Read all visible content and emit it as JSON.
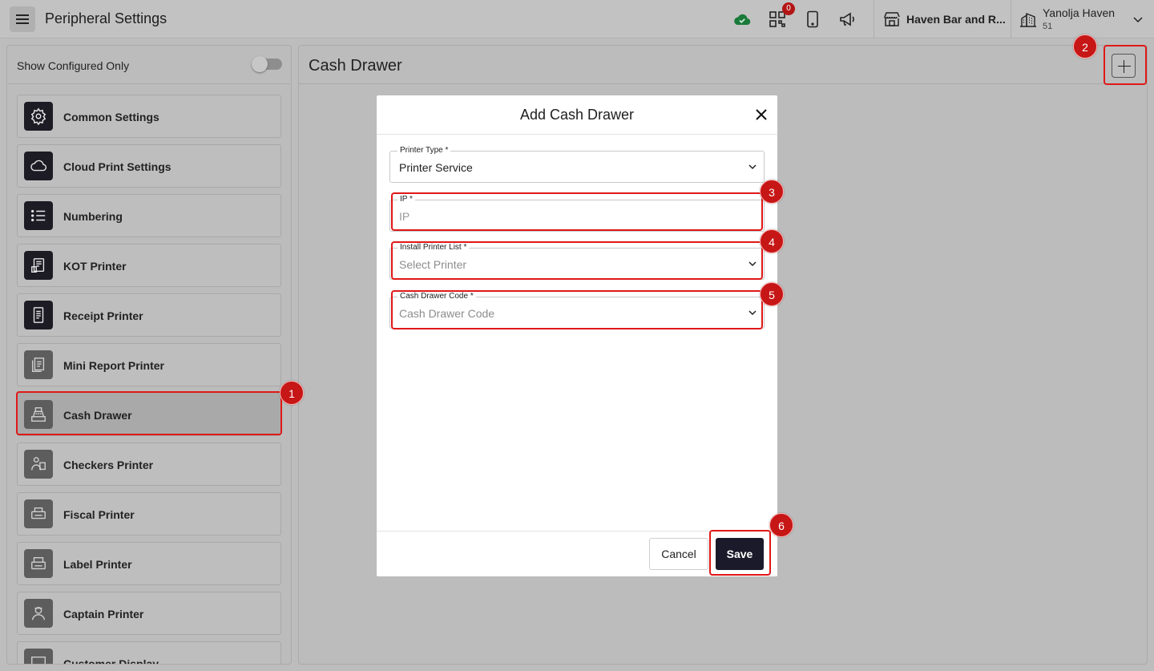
{
  "header": {
    "title": "Peripheral Settings",
    "notification_count": "0",
    "store_name": "Haven Bar and R...",
    "user_name": "Yanolja Haven",
    "user_sub": "51",
    "cloud_color": "#1a7a3a",
    "icons": [
      "cloud-check-icon",
      "qr-code-icon",
      "tablet-icon",
      "megaphone-icon",
      "store-icon",
      "building-icon",
      "chevron-down-icon"
    ]
  },
  "sidebar": {
    "toggle_label": "Show Configured Only",
    "toggle_on": false,
    "items": [
      {
        "label": "Common Settings",
        "icon": "gear-icon"
      },
      {
        "label": "Cloud Print Settings",
        "icon": "cloud-icon"
      },
      {
        "label": "Numbering",
        "icon": "list-icon"
      },
      {
        "label": "KOT Printer",
        "icon": "kot-printer-icon"
      },
      {
        "label": "Receipt Printer",
        "icon": "receipt-icon"
      },
      {
        "label": "Mini Report Printer",
        "icon": "report-icon"
      },
      {
        "label": "Cash Drawer",
        "icon": "cash-register-icon"
      },
      {
        "label": "Checkers Printer",
        "icon": "checker-icon"
      },
      {
        "label": "Fiscal Printer",
        "icon": "fiscal-printer-icon"
      },
      {
        "label": "Label Printer",
        "icon": "label-printer-icon"
      },
      {
        "label": "Captain Printer",
        "icon": "captain-icon"
      },
      {
        "label": "Customer Display",
        "icon": "display-icon"
      }
    ]
  },
  "main": {
    "title": "Cash Drawer"
  },
  "modal": {
    "title": "Add Cash Drawer",
    "fields": {
      "printer_type": {
        "label": "Printer Type *",
        "value": "Printer Service"
      },
      "ip": {
        "label": "IP *",
        "value": "",
        "placeholder": "IP"
      },
      "install_printer_list": {
        "label": "Install Printer List *",
        "placeholder": "Select Printer"
      },
      "cash_drawer_code": {
        "label": "Cash Drawer Code *",
        "placeholder": "Cash Drawer Code"
      }
    },
    "cancel_label": "Cancel",
    "save_label": "Save"
  },
  "annotations": [
    "1",
    "2",
    "3",
    "4",
    "5",
    "6"
  ],
  "annotation_color": "#e01818"
}
